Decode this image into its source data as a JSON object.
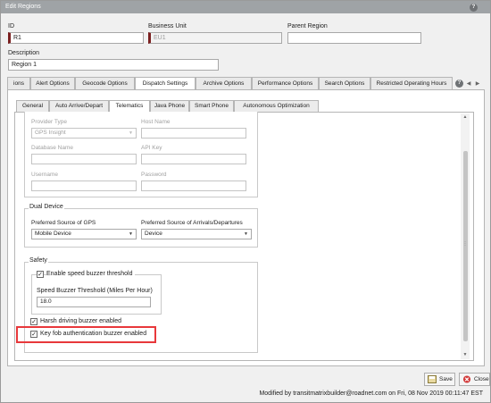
{
  "window": {
    "title": "Edit Regions"
  },
  "fields": {
    "id": {
      "label": "ID",
      "value": "R1"
    },
    "business_unit": {
      "label": "Business Unit",
      "value": "EU1"
    },
    "parent_region": {
      "label": "Parent Region",
      "value": ""
    },
    "description": {
      "label": "Description",
      "value": "Region 1"
    }
  },
  "main_tabs": [
    "ions",
    "Alert Options",
    "Geocode Options",
    "Dispatch Settings",
    "Archive Options",
    "Performance Options",
    "Search Options",
    "Restricted Operating Hours"
  ],
  "main_tab_active": "Dispatch Settings",
  "sub_tabs": [
    "General",
    "Auto Arrive/Depart",
    "Telematics",
    "Java Phone",
    "Smart Phone",
    "Autonomous Optimization"
  ],
  "sub_tab_active": "Telematics",
  "provider": {
    "provider_type_label": "Provider Type",
    "provider_type_value": "GPS Insight",
    "host_name_label": "Host Name",
    "database_name_label": "Database Name",
    "api_key_label": "API Key",
    "username_label": "Username",
    "password_label": "Password"
  },
  "dual_device": {
    "title": "Dual Device",
    "gps_label": "Preferred Source of GPS",
    "gps_value": "Mobile Device",
    "arrivals_label": "Preferred Source of Arrivals/Departures",
    "arrivals_value": "Device"
  },
  "safety": {
    "title": "Safety",
    "speed_buzzer_label": "Enable speed buzzer threshold",
    "speed_buzzer_checked": true,
    "threshold_label": "Speed Buzzer Threshold (Miles Per Hour)",
    "threshold_value": "18.0",
    "harsh_label": "Harsh driving buzzer enabled",
    "harsh_checked": true,
    "keyfob_label": "Key fob authentication buzzer enabled",
    "keyfob_checked": true
  },
  "buttons": {
    "save": "Save",
    "close": "Close"
  },
  "footer": {
    "modified": "Modified by transitmatrixbuilder@roadnet.com on Fri, 08 Nov 2019 00:11:47 EST"
  },
  "colors": {
    "titlebar": "#9fa3a6",
    "required_marker": "#7a1f1f",
    "highlight": "#e8383b"
  }
}
